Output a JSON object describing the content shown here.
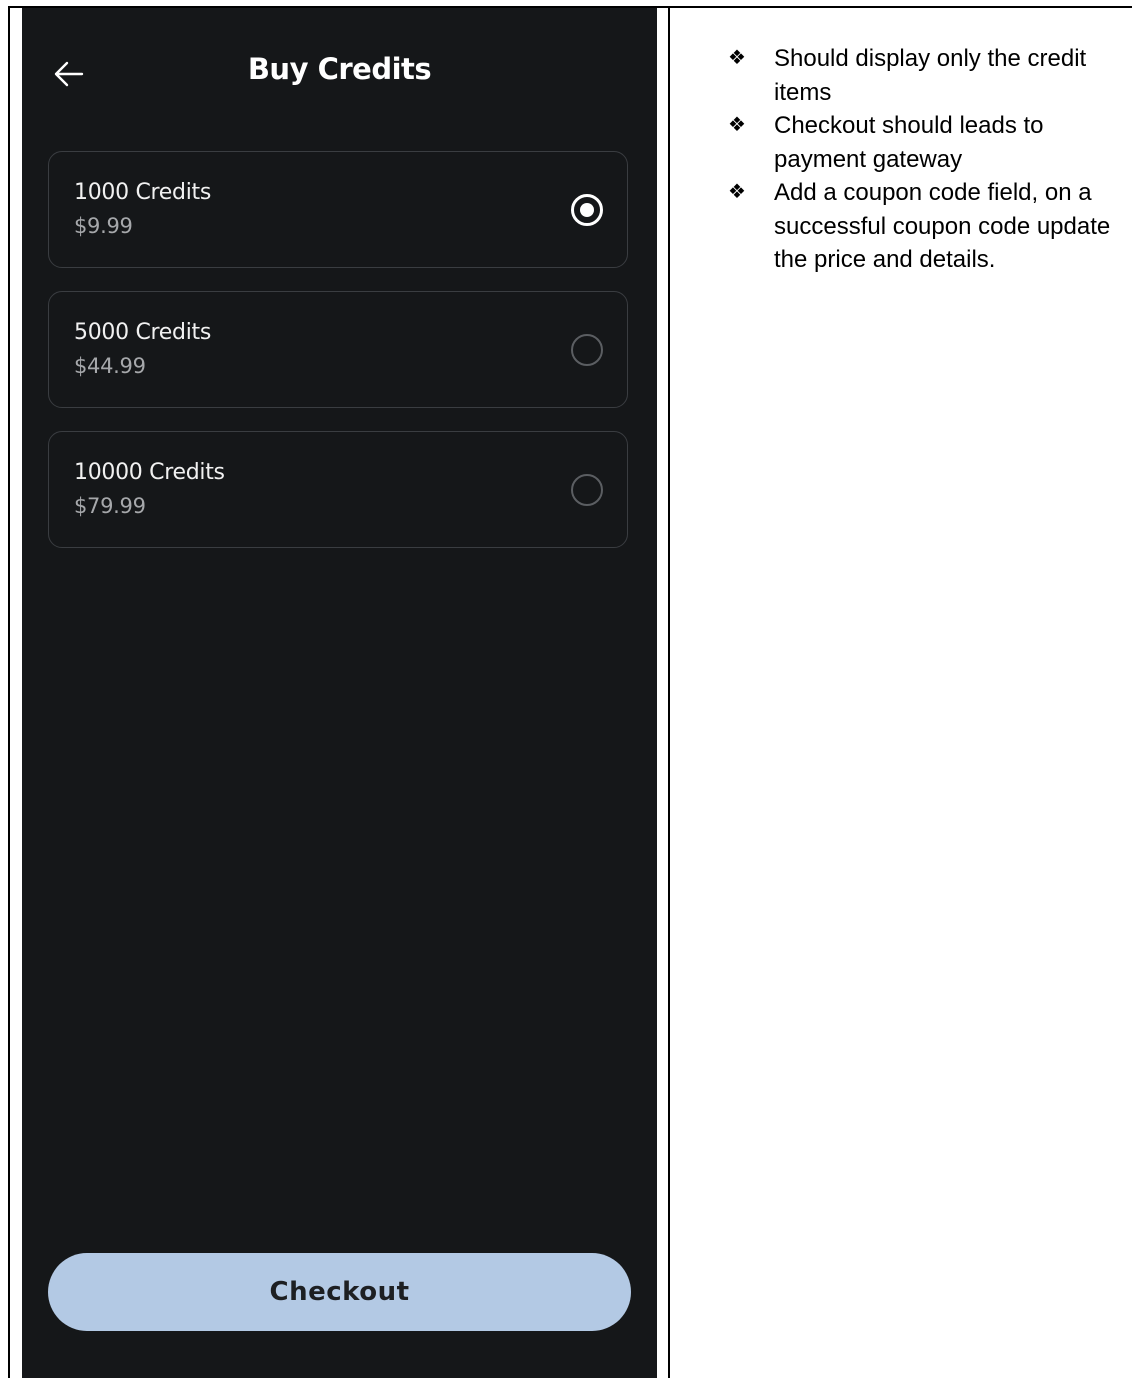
{
  "screen": {
    "title": "Buy Credits",
    "back_icon": "arrow-left-icon",
    "options": [
      {
        "label": "1000 Credits",
        "price": "$9.99",
        "selected": true
      },
      {
        "label": "5000 Credits",
        "price": "$44.99",
        "selected": false
      },
      {
        "label": "10000 Credits",
        "price": "$79.99",
        "selected": false
      }
    ],
    "checkout_label": "Checkout",
    "colors": {
      "background": "#151719",
      "card_border": "#3a3d41",
      "button": "#b3c9e4",
      "text_primary": "#f1f1f1",
      "text_secondary": "#a6a8ab"
    }
  },
  "notes": {
    "bullet_icon": "four-diamond-bullet-icon",
    "items": [
      "Should display only the credit items",
      "Checkout should leads to payment gateway",
      "Add a coupon code field, on a successful coupon code update the price and details."
    ]
  }
}
